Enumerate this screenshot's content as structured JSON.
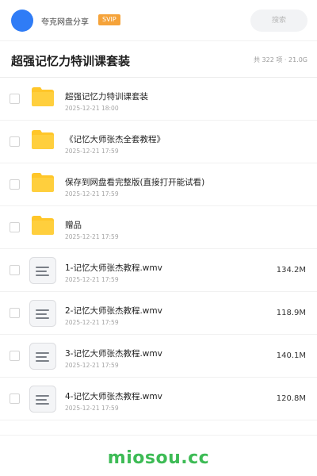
{
  "header": {
    "user_name": "夸克网盘分享",
    "badge": "SVIP",
    "search_placeholder": "搜索"
  },
  "title_bar": {
    "title": "超强记忆力特训课套装",
    "summary": "共 322 项 · 21.0G"
  },
  "items": [
    {
      "type": "folder",
      "name": "超强记忆力特训课套装",
      "date": "2025-12-21 18:00",
      "size": ""
    },
    {
      "type": "folder",
      "name": "《记忆大师张杰全套教程》",
      "date": "2025-12-21 17:59",
      "size": ""
    },
    {
      "type": "folder",
      "name": "保存到网盘看完整版(直接打开能试看)",
      "date": "2025-12-21 17:59",
      "size": ""
    },
    {
      "type": "folder",
      "name": "赠品",
      "date": "2025-12-21 17:59",
      "size": ""
    },
    {
      "type": "file",
      "name": "1-记忆大师张杰教程.wmv",
      "date": "2025-12-21 17:59",
      "size": "134.2M"
    },
    {
      "type": "file",
      "name": "2-记忆大师张杰教程.wmv",
      "date": "2025-12-21 17:59",
      "size": "118.9M"
    },
    {
      "type": "file",
      "name": "3-记忆大师张杰教程.wmv",
      "date": "2025-12-21 17:59",
      "size": "140.1M"
    },
    {
      "type": "file",
      "name": "4-记忆大师张杰教程.wmv",
      "date": "2025-12-21 17:59",
      "size": "120.8M"
    }
  ],
  "icons": {
    "folder": "folder-icon",
    "file": "document-icon",
    "checkbox": "checkbox-icon"
  },
  "colors": {
    "accent": "#2f7cf6",
    "badge": "#f5a33a",
    "folder": "#ffc629",
    "watermark": "#3dbb55"
  },
  "footer": {
    "watermark": "miosou.cc"
  }
}
